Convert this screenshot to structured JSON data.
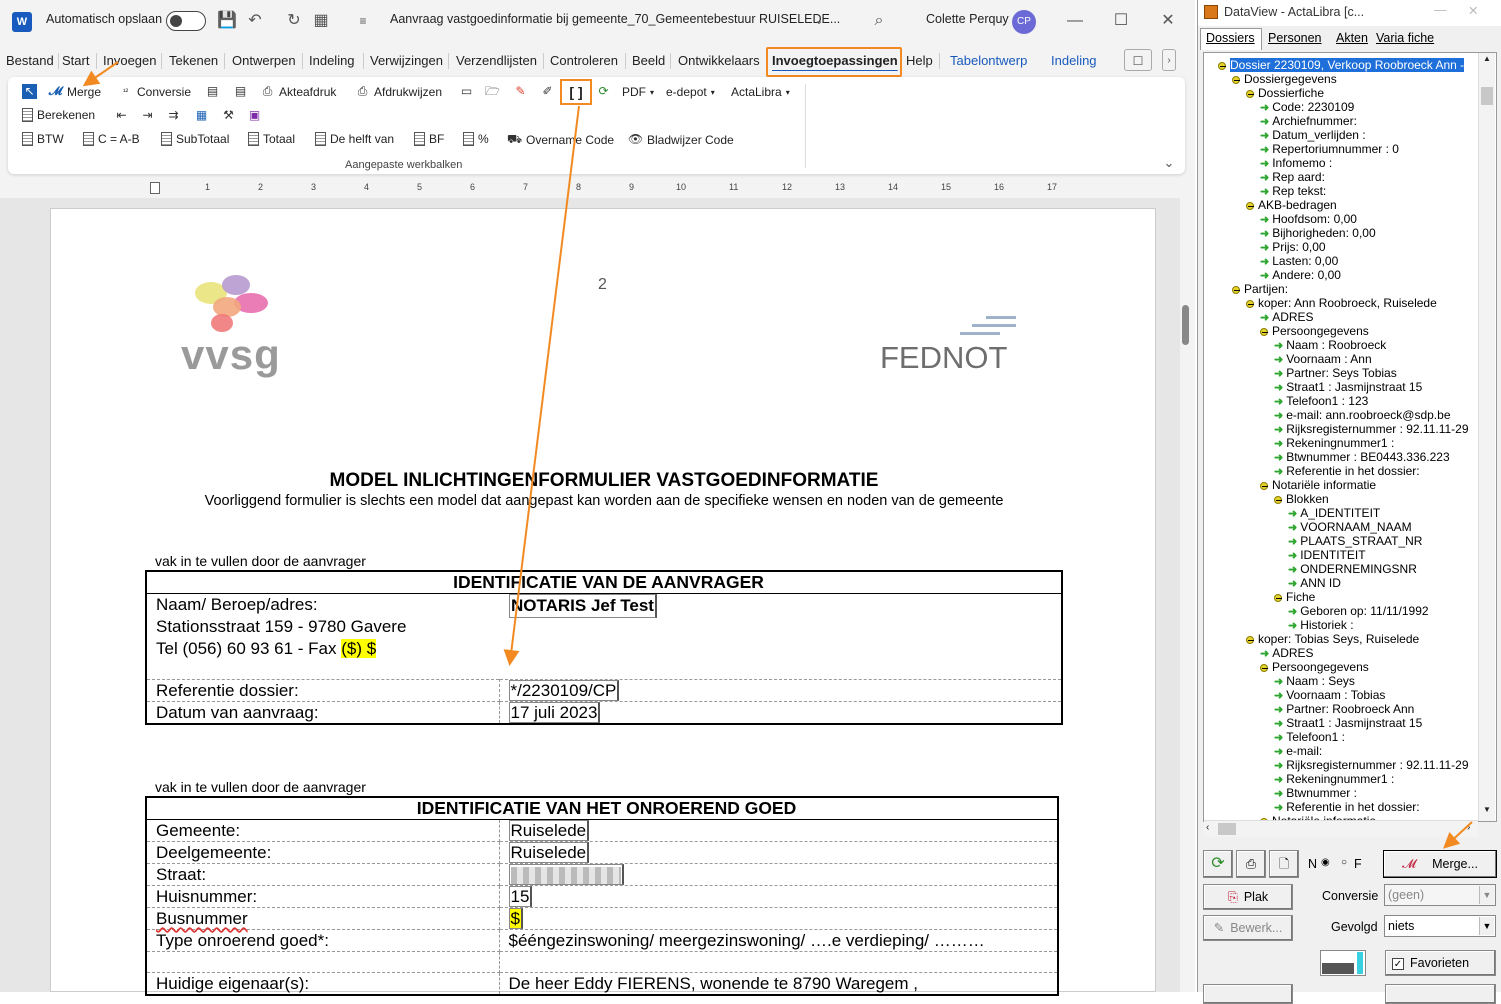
{
  "word": {
    "app_icon": "W",
    "autosave_label": "Automatisch opslaan",
    "doc_title": "Aanvraag vastgoedinformatie bij gemeente_70_Gemeentebestuur RUISELEDE...",
    "user_name": "Colette Perquy",
    "user_initials": "CP",
    "tabs": [
      "Bestand",
      "Start",
      "Invoegen",
      "Tekenen",
      "Ontwerpen",
      "Indeling",
      "Verwijzingen",
      "Verzendlijsten",
      "Controleren",
      "Beeld",
      "Ontwikkelaars",
      "Invoegtoepassingen",
      "Help",
      "Tabelontwerp",
      "Indeling"
    ],
    "ribbon": {
      "row1": {
        "merge": "Merge",
        "conversie": "Conversie",
        "akteafdruk": "Akteafdruk",
        "afdrukwijzen": "Afdrukwijzen",
        "bracket": "[ ]",
        "pdf": "PDF",
        "edepot": "e-depot",
        "actalibra": "ActaLibra"
      },
      "row2": {
        "berekenen": "Berekenen"
      },
      "row3": {
        "btw": "BTW",
        "camb": "C = A-B",
        "subtotaal": "SubTotaal",
        "totaal": "Totaal",
        "helft": "De helft van",
        "bf": "BF",
        "pct": "%",
        "overname": "Overname Code",
        "bladwijzer": "Bladwijzer Code"
      },
      "group_label": "Aangepaste werkbalken"
    },
    "ruler_ticks": [
      "1",
      "2",
      "3",
      "4",
      "5",
      "6",
      "7",
      "8",
      "9",
      "10",
      "11",
      "12",
      "13",
      "14",
      "15",
      "16",
      "17"
    ]
  },
  "document": {
    "page_number": "2",
    "logo_left": "vvsg",
    "logo_right": "FEDNOT",
    "title": "MODEL INLICHTINGENFORMULIER VASTGOEDINFORMATIE",
    "subtitle": "Voorliggend formulier is slechts een model dat aangepast kan worden aan de specifieke wensen en noden van de gemeente",
    "section1_caption": "vak in te vullen door de aanvrager",
    "table1": {
      "header": "IDENTIFICATIE VAN DE AANVRAGER",
      "name_label": "Naam/ Beroep/adres:",
      "name_value": "NOTARIS Jef Test",
      "address": "Stationsstraat 159 - 9780 Gavere",
      "tel_prefix": "Tel (056) 60 93 61 - Fax ",
      "tel_placeholder": "($) $",
      "ref_label": "Referentie dossier:",
      "ref_value": "*/2230109/CP",
      "date_label": "Datum van aanvraag:",
      "date_value": "17 juli 2023"
    },
    "section2_caption": "vak in te vullen door de aanvrager",
    "table2": {
      "header": "IDENTIFICATIE VAN HET ONROEREND GOED",
      "rows": [
        {
          "label": "Gemeente:",
          "value": "Ruiselede"
        },
        {
          "label": "Deelgemeente:",
          "value": "Ruiselede"
        },
        {
          "label": "Straat:",
          "value": ""
        },
        {
          "label": "Huisnummer:",
          "value": "15"
        },
        {
          "label": "Busnummer",
          "value": "$"
        },
        {
          "label": "Type onroerend goed*:",
          "value": "$ééngezinswoning/ meergezinswoning/ ….e verdieping/ ………"
        },
        {
          "label": "",
          "value": ""
        },
        {
          "label": "Huidige eigenaar(s):",
          "value": "De heer Eddy FIERENS, wonende te 8790 Waregem ,"
        }
      ]
    }
  },
  "dataview": {
    "title": "DataView - ActaLibra [c...",
    "tabs": [
      "Dossiers",
      "Personen",
      "Akten",
      "Varia fiche"
    ],
    "tree": [
      {
        "t": "Dossier 2230109, Verkoop Roobroeck Ann - ",
        "k": "root",
        "lvl": 0
      },
      {
        "t": "Dossiergegevens",
        "k": "folder",
        "lvl": 1
      },
      {
        "t": "Dossierfiche",
        "k": "folder",
        "lvl": 2
      },
      {
        "t": "Code: 2230109",
        "k": "leaf",
        "lvl": 3
      },
      {
        "t": "Archiefnummer:",
        "k": "leaf",
        "lvl": 3
      },
      {
        "t": "Datum_verlijden :",
        "k": "leaf",
        "lvl": 3
      },
      {
        "t": "Repertoriumnummer :  0",
        "k": "leaf",
        "lvl": 3
      },
      {
        "t": "Infomemo :",
        "k": "leaf",
        "lvl": 3
      },
      {
        "t": "Rep aard:",
        "k": "leaf",
        "lvl": 3
      },
      {
        "t": "Rep tekst:",
        "k": "leaf",
        "lvl": 3
      },
      {
        "t": "AKB-bedragen",
        "k": "folder",
        "lvl": 2
      },
      {
        "t": "Hoofdsom: 0,00",
        "k": "leaf",
        "lvl": 3
      },
      {
        "t": "Bijhorigheden: 0,00",
        "k": "leaf",
        "lvl": 3
      },
      {
        "t": "Prijs: 0,00",
        "k": "leaf",
        "lvl": 3
      },
      {
        "t": "Lasten: 0,00",
        "k": "leaf",
        "lvl": 3
      },
      {
        "t": "Andere: 0,00",
        "k": "leaf",
        "lvl": 3
      },
      {
        "t": "Partijen:",
        "k": "folder",
        "lvl": 1
      },
      {
        "t": "koper: Ann Roobroeck, Ruiselede",
        "k": "folder",
        "lvl": 2
      },
      {
        "t": "ADRES",
        "k": "leaf",
        "lvl": 3
      },
      {
        "t": "Persoongegevens",
        "k": "folder",
        "lvl": 3
      },
      {
        "t": "Naam :  Roobroeck",
        "k": "leaf",
        "lvl": 4
      },
      {
        "t": "Voornaam :  Ann",
        "k": "leaf",
        "lvl": 4
      },
      {
        "t": "Partner: Seys Tobias",
        "k": "leaf",
        "lvl": 4
      },
      {
        "t": "Straat1 :  Jasmijnstraat 15",
        "k": "leaf",
        "lvl": 4
      },
      {
        "t": "Telefoon1 :  123",
        "k": "leaf",
        "lvl": 4
      },
      {
        "t": "e-mail: ann.roobroeck@sdp.be",
        "k": "leaf",
        "lvl": 4
      },
      {
        "t": "Rijksregisternummer :  92.11.11-29",
        "k": "leaf",
        "lvl": 4
      },
      {
        "t": "Rekeningnummer1 :",
        "k": "leaf",
        "lvl": 4
      },
      {
        "t": "Btwnummer :  BE0443.336.223",
        "k": "leaf",
        "lvl": 4
      },
      {
        "t": "Referentie in het dossier:",
        "k": "leaf",
        "lvl": 4
      },
      {
        "t": "Notariële informatie",
        "k": "folder",
        "lvl": 3
      },
      {
        "t": "Blokken",
        "k": "folder",
        "lvl": 4
      },
      {
        "t": "A_IDENTITEIT",
        "k": "leaf",
        "lvl": 5
      },
      {
        "t": "VOORNAAM_NAAM",
        "k": "leaf",
        "lvl": 5
      },
      {
        "t": "PLAATS_STRAAT_NR",
        "k": "leaf",
        "lvl": 5
      },
      {
        "t": "IDENTITEIT",
        "k": "leaf",
        "lvl": 5
      },
      {
        "t": "ONDERNEMINGSNR",
        "k": "leaf",
        "lvl": 5
      },
      {
        "t": "ANN ID",
        "k": "leaf",
        "lvl": 5
      },
      {
        "t": "Fiche",
        "k": "folder",
        "lvl": 4
      },
      {
        "t": "Geboren op: 11/11/1992",
        "k": "leaf",
        "lvl": 5
      },
      {
        "t": "Historiek :",
        "k": "leaf",
        "lvl": 5
      },
      {
        "t": "koper: Tobias Seys, Ruiselede",
        "k": "folder",
        "lvl": 2
      },
      {
        "t": "ADRES",
        "k": "leaf",
        "lvl": 3
      },
      {
        "t": "Persoongegevens",
        "k": "folder",
        "lvl": 3
      },
      {
        "t": "Naam :  Seys",
        "k": "leaf",
        "lvl": 4
      },
      {
        "t": "Voornaam :  Tobias",
        "k": "leaf",
        "lvl": 4
      },
      {
        "t": "Partner: Roobroeck Ann",
        "k": "leaf",
        "lvl": 4
      },
      {
        "t": "Straat1 :  Jasmijnstraat 15",
        "k": "leaf",
        "lvl": 4
      },
      {
        "t": "Telefoon1 :",
        "k": "leaf",
        "lvl": 4
      },
      {
        "t": "e-mail:",
        "k": "leaf",
        "lvl": 4
      },
      {
        "t": "Rijksregisternummer :  92.11.11-29",
        "k": "leaf",
        "lvl": 4
      },
      {
        "t": "Rekeningnummer1 :",
        "k": "leaf",
        "lvl": 4
      },
      {
        "t": "Btwnummer :",
        "k": "leaf",
        "lvl": 4
      },
      {
        "t": "Referentie in het dossier:",
        "k": "leaf",
        "lvl": 4
      },
      {
        "t": "Notariële informatie",
        "k": "folder",
        "lvl": 3
      }
    ],
    "controls": {
      "radio_n": "N",
      "radio_f": "F",
      "merge": "Merge...",
      "plak": "Plak",
      "conversie_label": "Conversie",
      "conversie_value": "(geen)",
      "bewerk": "Bewerk...",
      "gevolgd_label": "Gevolgd",
      "gevolgd_value": "niets",
      "favorieten": "Favorieten"
    }
  },
  "colors": {
    "accent_orange": "#f28a21",
    "word_blue": "#185abd",
    "tree_select": "#1e6fd9",
    "highlight": "#ffff00"
  }
}
